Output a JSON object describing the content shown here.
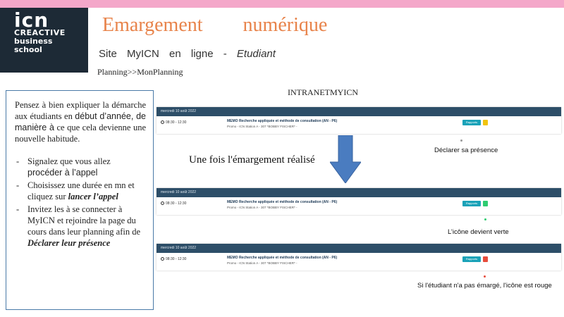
{
  "logo": {
    "line1": "icn",
    "line2": "CREACTIVE",
    "line3": "business",
    "line4": "school"
  },
  "header": {
    "title": "Emargement numérique",
    "subtitle_main": "Site MyICN en ligne -",
    "subtitle_italic": "Etudiant",
    "breadcrumb": "Planning>>MonPlanning"
  },
  "intranet_label": "INTRANETMYICN",
  "instructions": {
    "intro_part1": "Pensez à bien expliquer la démarche aux étudiants en",
    "intro_part2": "début d’année, de manière à",
    "intro_part3": "ce que cela devienne une nouvelle habitude.",
    "item1_part1": "Signalez que vous allez",
    "item1_part2": "procéder à l’appel",
    "item2_part1": "Choisissez une durée en mn et cliquez sur",
    "item2_emph": "lancer l’appel",
    "item3_part1": "Invitez les à se connecter à MyICN et rejoindre la page du cours dans leur planning afin de",
    "item3_emph": "Déclarer leur présence"
  },
  "panels": [
    {
      "date": "mercredi 10 août 2022",
      "time": "08:30 - 12:30",
      "course": "MEMO Recherche appliquée et méthode de consultation (AN - P6)",
      "meta": "Promo - ICN Station A - 307 *BOBBY FISCHER* -",
      "button": "Rapports",
      "status_color": "#f1c40f"
    },
    {
      "date": "mercredi 10 août 2022",
      "time": "08:30 - 12:30",
      "course": "MEMO Recherche appliquée et méthode de consultation (AN - P6)",
      "meta": "Promo - ICN Station A - 307 *BOBBY FISCHER* -",
      "button": "Rapports",
      "status_color": "#2ecc71"
    },
    {
      "date": "mercredi 10 août 2022",
      "time": "08:30 - 12:30",
      "course": "MEMO Recherche appliquée et méthode de consultation (AN - P6)",
      "meta": "Promo - ICN Station A - 307 *BOBBY FISCHER* -",
      "button": "Rapports",
      "status_color": "#e74c3c"
    }
  ],
  "transition_text": "Une fois l'émargement réalisé",
  "callouts": {
    "declare": "Déclarer sa présence",
    "green": "L’icône devient verte",
    "red": "Si l'étudiant n'a pas émargé, l'icône est rouge"
  },
  "colors": {
    "accent": "#e8834a",
    "panel_header": "#2d4e68",
    "arrow": "#4a7cc0",
    "topbar": "#f4a7c9"
  }
}
